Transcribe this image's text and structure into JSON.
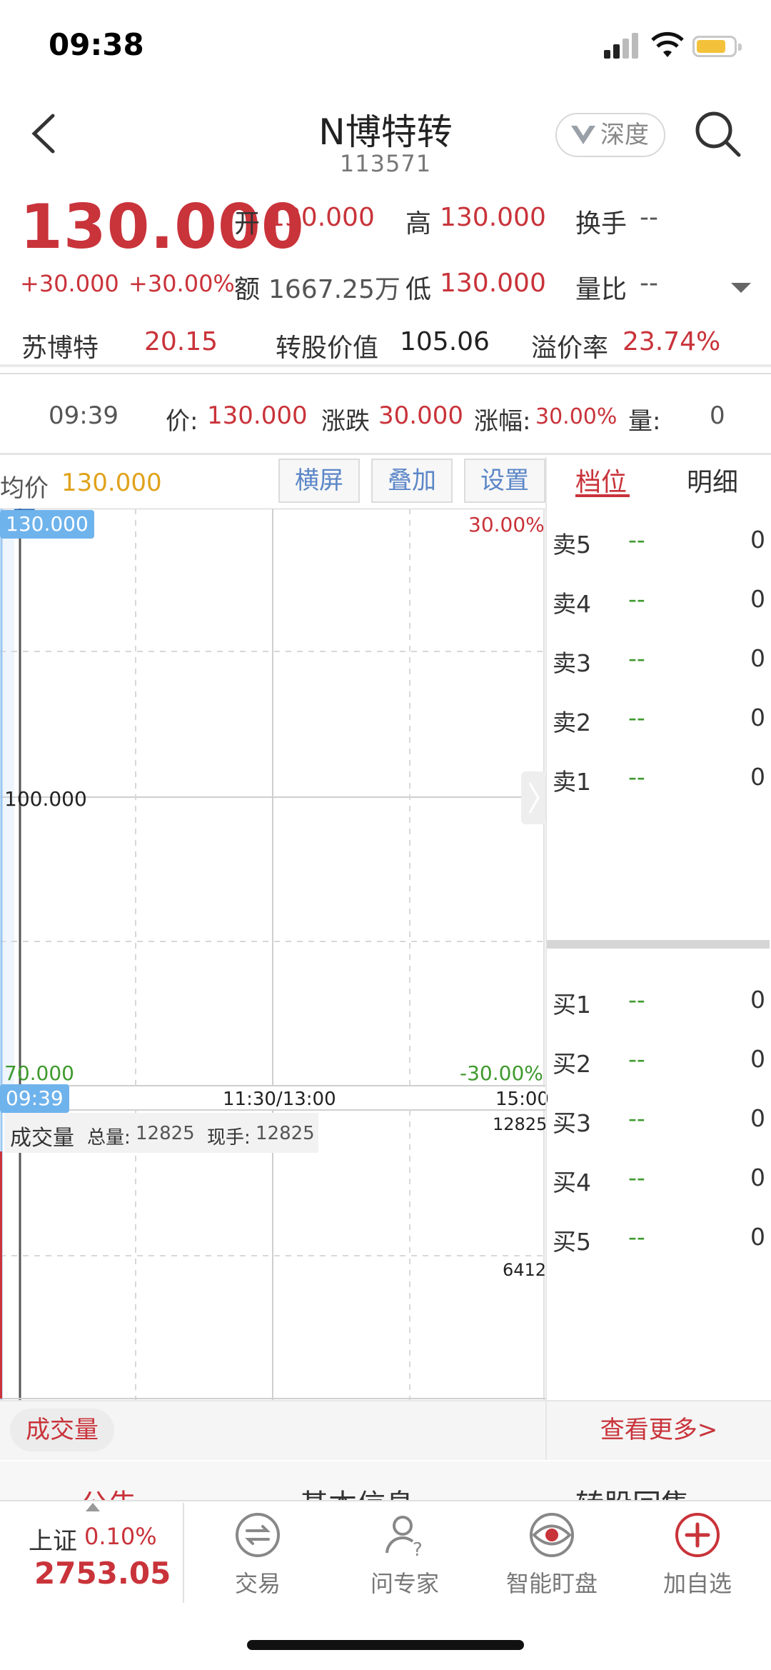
{
  "status": {
    "time": "09:38"
  },
  "header": {
    "title": "N博特转",
    "code": "113571",
    "depth_label": "深度"
  },
  "quote": {
    "price": "130.000",
    "change": "+30.000",
    "change_pct": "+30.00%",
    "open_label": "开",
    "open": "130.000",
    "high_label": "高",
    "high": "130.000",
    "turnover_label": "换手",
    "turnover": "--",
    "amount_label": "额",
    "amount": "1667.25万",
    "low_label": "低",
    "low": "130.000",
    "volume_ratio_label": "量比",
    "volume_ratio": "--"
  },
  "stock_line": {
    "stock_name": "苏博特",
    "stock_price": "20.15",
    "conv_value_label": "转股价值",
    "conv_value": "105.06",
    "premium_label": "溢价率",
    "premium": "23.74%"
  },
  "info_bar": {
    "time": "09:39",
    "price_label": "价:",
    "price": "130.000",
    "change_label": "涨跌",
    "change": "30.000",
    "pct_label": "涨幅:",
    "pct": "30.00%",
    "vol_label": "量:",
    "vol": "0"
  },
  "chart_toolbar": {
    "avg_label": "均价",
    "avg_value": "130.000",
    "landscape": "横屏",
    "overlay": "叠加",
    "settings": "设置"
  },
  "chart_data": {
    "type": "line",
    "price_top": "130.000",
    "price_mid": "100.000",
    "price_bottom": "70.000",
    "pct_top": "30.00%",
    "pct_bottom": "-30.00%",
    "current_time_tag": "09:39",
    "x_mid_label": "11:30/13:00",
    "x_end_label": "15:00",
    "ylim": [
      70,
      130
    ],
    "price_series": [
      {
        "time": "09:30",
        "price": 130
      },
      {
        "time": "09:39",
        "price": 130
      }
    ],
    "volume": {
      "title": "成交量",
      "total_label": "总量:",
      "total": "12825",
      "current_label": "现手:",
      "current": "12825",
      "max_label": "12825",
      "mid_label": "6412"
    }
  },
  "order_book": {
    "tab_active": "档位",
    "tab_other": "明细",
    "sells": [
      {
        "label": "卖5",
        "price": "--",
        "vol": "0"
      },
      {
        "label": "卖4",
        "price": "--",
        "vol": "0"
      },
      {
        "label": "卖3",
        "price": "--",
        "vol": "0"
      },
      {
        "label": "卖2",
        "price": "--",
        "vol": "0"
      },
      {
        "label": "卖1",
        "price": "--",
        "vol": "0"
      }
    ],
    "buys": [
      {
        "label": "买1",
        "price": "--",
        "vol": "0"
      },
      {
        "label": "买2",
        "price": "--",
        "vol": "0"
      },
      {
        "label": "买3",
        "price": "--",
        "vol": "0"
      },
      {
        "label": "买4",
        "price": "--",
        "vol": "0"
      },
      {
        "label": "买5",
        "price": "--",
        "vol": "0"
      }
    ],
    "more": "查看更多>"
  },
  "volume_button": "成交量",
  "sub_tabs": [
    "公告",
    "基本信息",
    "转股回售"
  ],
  "bottom_nav": {
    "index_name": "上证",
    "index_pct": "0.10%",
    "index_value": "2753.05",
    "items": [
      "交易",
      "问专家",
      "智能盯盘",
      "加自选"
    ]
  },
  "colors": {
    "up": "#c9333a",
    "down": "#3f9a2e",
    "accent_blue": "#6fb3ec",
    "avg_gold": "#e0a21b"
  }
}
